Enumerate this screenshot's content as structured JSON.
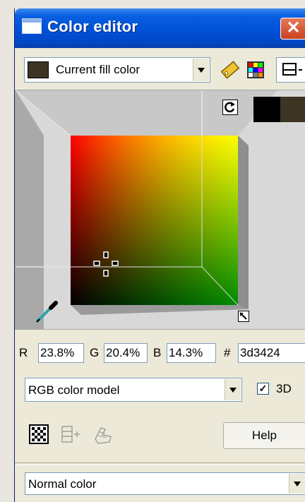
{
  "window": {
    "title": "Color editor"
  },
  "top": {
    "fill_selector": "Current fill color"
  },
  "color": {
    "hex_value": "#3d3424",
    "r_label": "R",
    "r_value": "23.8%",
    "g_label": "G",
    "g_value": "20.4%",
    "b_label": "B",
    "b_value": "14.3%",
    "hash_label": "#",
    "hex_field": "3d3424"
  },
  "model": {
    "selected": "RGB color model",
    "checkbox_label": "3D",
    "checked": true
  },
  "actions": {
    "help_label": "Help"
  },
  "bottom": {
    "mode_selected": "Normal color"
  },
  "icons": {
    "window": "window-icon",
    "close": "close-icon",
    "tag": "tag-icon",
    "palette": "palette-grid-icon",
    "panel": "panel-icon",
    "reset": "reset-icon",
    "eyedropper": "eyedropper-icon",
    "resize": "resize-icon",
    "checker": "checkerboard-icon",
    "list_add": "list-add-icon",
    "hand": "hand-icon",
    "dropdown": "chevron-down-icon"
  }
}
